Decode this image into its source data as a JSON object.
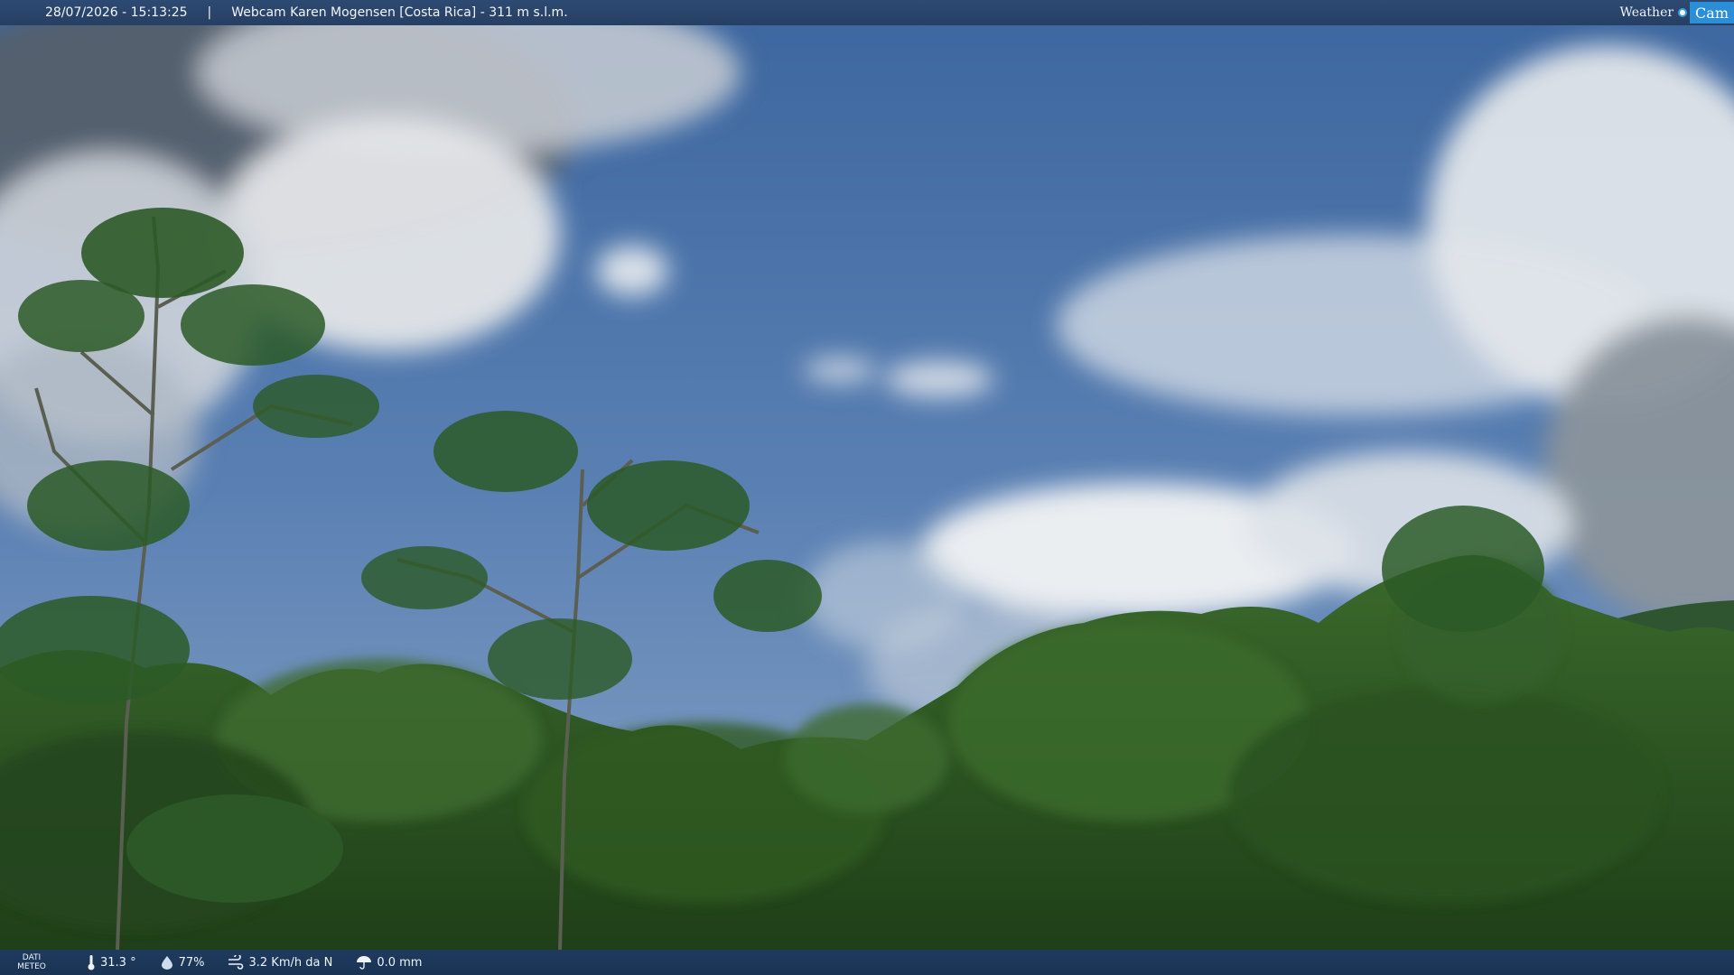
{
  "header": {
    "datetime": "28/07/2026 - 15:13:25",
    "separator": "|",
    "title": "Webcam Karen Mogensen [Costa Rica] - 311 m s.l.m."
  },
  "logo": {
    "word1": "Weather",
    "word2": "Cam"
  },
  "footer": {
    "label_line1": "DATI",
    "label_line2": "METEO",
    "temperature": "31.3 °",
    "humidity": "77%",
    "wind": "3.2 Km/h da N",
    "rain": "0.0 mm"
  },
  "colors": {
    "sky_top": "#3f6aa3",
    "sky_bottom": "#7f9ec4",
    "foliage": "#2d5a24",
    "bar": "#263f63"
  }
}
